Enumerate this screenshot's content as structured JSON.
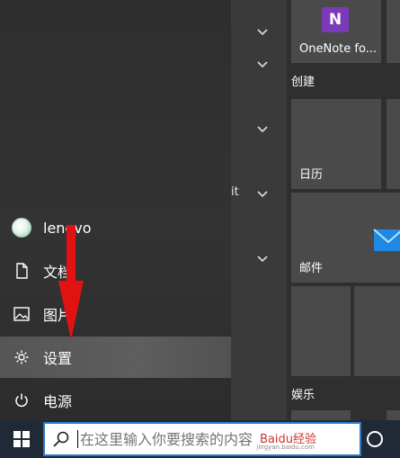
{
  "user": {
    "name": "lenovo"
  },
  "menu": {
    "documents": "文档",
    "pictures": "图片",
    "settings": "设置",
    "power": "电源"
  },
  "applist": {
    "partial_text": "it"
  },
  "tiles": {
    "groups": {
      "create": "创建",
      "entertainment": "娱乐"
    },
    "onenote": {
      "label": "OneNote fo...",
      "icon_letter": "N"
    },
    "calendar": {
      "label": "日历"
    },
    "mail": {
      "label": "邮件"
    }
  },
  "taskbar": {
    "search_placeholder": "在这里输入你要搜索的内容",
    "watermark": "Baidu经验",
    "watermark_sub": "jingyan.baidu.com"
  },
  "colors": {
    "accent_arrow": "#e31212",
    "search_border": "#2f79c8",
    "onenote": "#7b3bb8",
    "mail": "#1e88e5"
  }
}
